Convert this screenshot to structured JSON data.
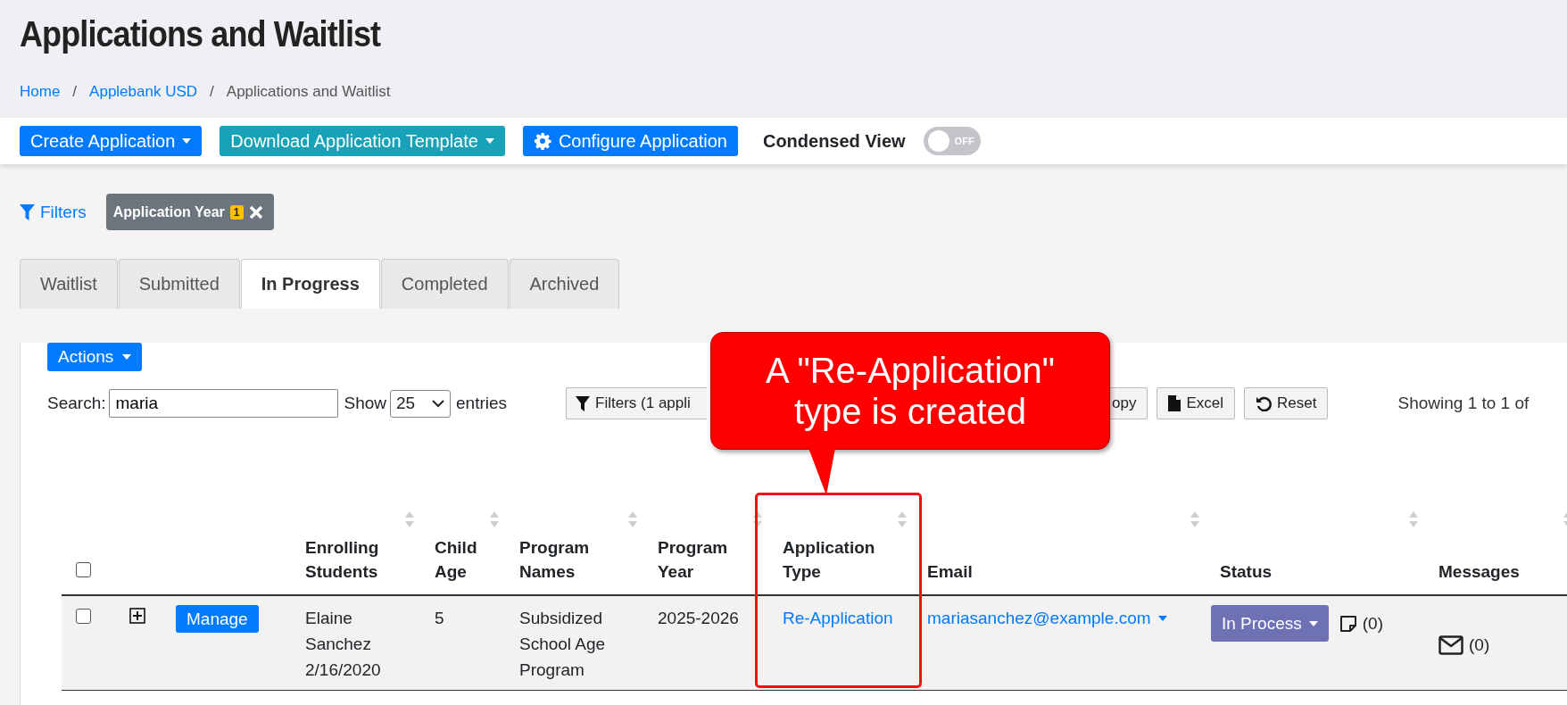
{
  "page_title": "Applications and Waitlist",
  "breadcrumb": {
    "separator": "/",
    "items": [
      {
        "label": "Home",
        "link": true
      },
      {
        "label": "Applebank USD",
        "link": true
      },
      {
        "label": "Applications and Waitlist",
        "link": false
      }
    ]
  },
  "toolbar": {
    "buttons": [
      {
        "label": "Create Application",
        "kind": "dropdown",
        "color": "#007bff"
      },
      {
        "label": "Download Application Template",
        "kind": "dropdown",
        "color": "#17a2b8"
      },
      {
        "label": "Configure Application",
        "kind": "gear",
        "color": "#007bff"
      }
    ],
    "condensed_view": {
      "label": "Condensed View",
      "on": false,
      "state_text": "OFF"
    }
  },
  "filters": {
    "label": "Filters",
    "chips": [
      {
        "label": "Application Year",
        "count": "1"
      }
    ]
  },
  "tabs": [
    {
      "label": "Waitlist",
      "selected": false
    },
    {
      "label": "Submitted",
      "selected": false
    },
    {
      "label": "In Progress",
      "selected": true
    },
    {
      "label": "Completed",
      "selected": false
    },
    {
      "label": "Archived",
      "selected": false
    }
  ],
  "actions_button": "Actions",
  "search": {
    "label": "Search:",
    "value": "maria"
  },
  "show": {
    "label": "Show",
    "value": "25",
    "suffix": "entries"
  },
  "table_buttons": [
    {
      "label": "Filters (1 appli",
      "kind": "filter"
    },
    {
      "label": "opy",
      "kind": "copy"
    },
    {
      "label": "Excel",
      "kind": "excel"
    },
    {
      "label": "Reset",
      "kind": "reset"
    }
  ],
  "showing": "Showing 1 to 1 of",
  "table": {
    "select_all_checked": false,
    "columns": [
      "",
      "",
      "",
      "Enrolling Students",
      "Child Age",
      "Program Names",
      "Program Year",
      "Application Type",
      "Email",
      "Status",
      "Messages"
    ],
    "rows": [
      {
        "checked": false,
        "expanded": false,
        "manage": "Manage",
        "student": "Elaine Sanchez",
        "birth_date": "2/16/2020",
        "child_age": "5",
        "program_names": "Subsidized School Age Program",
        "program_year": "2025-2026",
        "application_type": "Re-Application",
        "email": "mariasanchez@example.com",
        "status": "In Process",
        "notes_count": "(0)",
        "messages_count": "(0)"
      }
    ]
  },
  "callout": {
    "text": "A \"Re-Application\" type is created"
  }
}
